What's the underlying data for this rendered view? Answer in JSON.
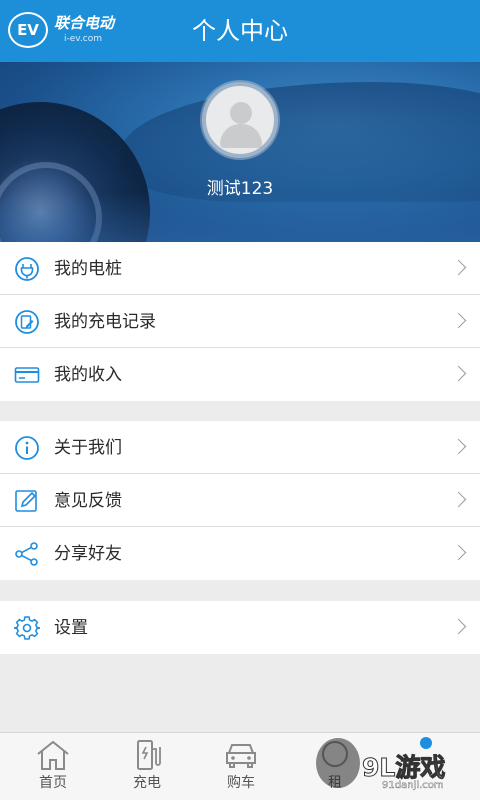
{
  "header": {
    "logo_text": "EV",
    "logo_name": "联合电动",
    "logo_url": "i-ev.com",
    "title": "个人中心"
  },
  "profile": {
    "username": "测试123"
  },
  "menu_groups": [
    {
      "items": [
        {
          "label": "我的电桩",
          "icon": "charging-plug-icon"
        },
        {
          "label": "我的充电记录",
          "icon": "charge-record-icon"
        },
        {
          "label": "我的收入",
          "icon": "income-card-icon"
        }
      ]
    },
    {
      "items": [
        {
          "label": "关于我们",
          "icon": "info-icon"
        },
        {
          "label": "意见反馈",
          "icon": "feedback-edit-icon"
        },
        {
          "label": "分享好友",
          "icon": "share-icon"
        }
      ]
    },
    {
      "items": [
        {
          "label": "设置",
          "icon": "gear-icon"
        }
      ]
    }
  ],
  "bottom_nav": [
    {
      "label": "首页",
      "icon": "home-icon"
    },
    {
      "label": "充电",
      "icon": "charger-station-icon"
    },
    {
      "label": "购车",
      "icon": "car-icon"
    },
    {
      "label": "租",
      "icon": "rent-icon"
    },
    {
      "label": "",
      "icon": "profile-icon"
    }
  ],
  "watermark": {
    "main": "9L游戏",
    "sub": "91danji.com"
  },
  "colors": {
    "accent": "#1c8fd8",
    "icon_blue": "#1e8ee0",
    "background": "#ececec"
  }
}
